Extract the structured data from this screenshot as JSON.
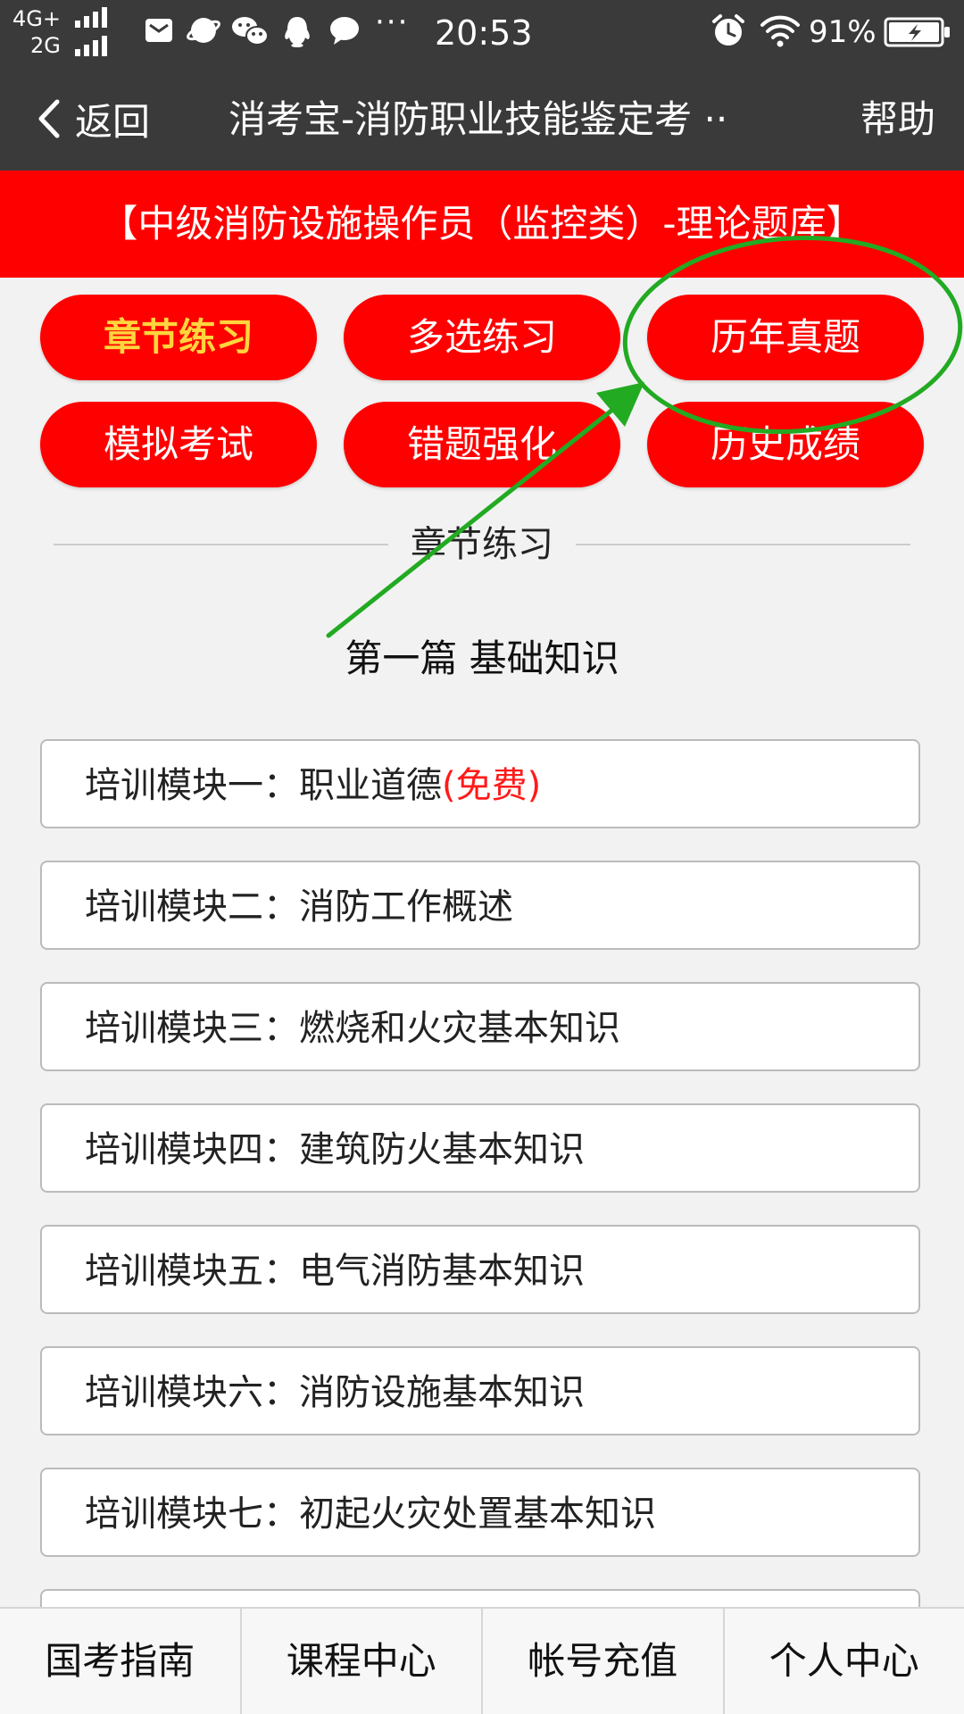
{
  "status_bar": {
    "network_top": "4G+",
    "network_bottom": "2G",
    "time": "20:53",
    "battery_percent": "91%",
    "more": "···",
    "icons": [
      "mail-icon",
      "browser-icon",
      "wechat-icon",
      "qq-icon",
      "message-icon",
      "alarm-icon",
      "wifi-icon",
      "battery-icon"
    ]
  },
  "title_bar": {
    "back_label": "返回",
    "title": "消考宝-消防职业技能鉴定考 ··",
    "help_label": "帮助"
  },
  "banner": {
    "text": "【中级消防设施操作员（监控类）-理论题库】"
  },
  "actions": [
    {
      "label": "章节练习"
    },
    {
      "label": "多选练习"
    },
    {
      "label": "历年真题"
    },
    {
      "label": "模拟考试"
    },
    {
      "label": "错题强化"
    },
    {
      "label": "历史成绩"
    }
  ],
  "active_action": "章节练习",
  "section": {
    "title": "章节练习",
    "part_title": "第一篇 基础知识"
  },
  "modules": [
    {
      "label": "培训模块一：职业道德",
      "tag": "(免费)"
    },
    {
      "label": "培训模块二：消防工作概述",
      "tag": ""
    },
    {
      "label": "培训模块三：燃烧和火灾基本知识",
      "tag": ""
    },
    {
      "label": "培训模块四：建筑防火基本知识",
      "tag": ""
    },
    {
      "label": "培训模块五：电气消防基本知识",
      "tag": ""
    },
    {
      "label": "培训模块六：消防设施基本知识",
      "tag": ""
    },
    {
      "label": "培训模块七：初起火灾处置基本知识",
      "tag": ""
    }
  ],
  "bottom_nav": [
    {
      "label": "国考指南"
    },
    {
      "label": "课程中心"
    },
    {
      "label": "帐号充值"
    },
    {
      "label": "个人中心"
    }
  ],
  "colors": {
    "header_bg": "#3a3a3a",
    "brand_red": "#ff0000",
    "active_text": "#ffd53d",
    "free_tag": "#ff1a1a",
    "annotation_green": "#22aa22"
  }
}
